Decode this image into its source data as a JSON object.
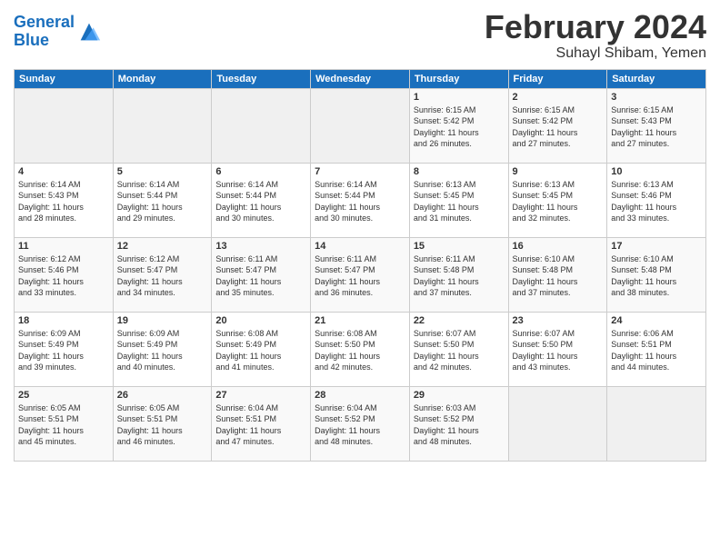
{
  "header": {
    "logo_line1": "General",
    "logo_line2": "Blue",
    "month": "February 2024",
    "location": "Suhayl Shibam, Yemen"
  },
  "days_of_week": [
    "Sunday",
    "Monday",
    "Tuesday",
    "Wednesday",
    "Thursday",
    "Friday",
    "Saturday"
  ],
  "weeks": [
    [
      {
        "day": "",
        "info": ""
      },
      {
        "day": "",
        "info": ""
      },
      {
        "day": "",
        "info": ""
      },
      {
        "day": "",
        "info": ""
      },
      {
        "day": "1",
        "info": "Sunrise: 6:15 AM\nSunset: 5:42 PM\nDaylight: 11 hours\nand 26 minutes."
      },
      {
        "day": "2",
        "info": "Sunrise: 6:15 AM\nSunset: 5:42 PM\nDaylight: 11 hours\nand 27 minutes."
      },
      {
        "day": "3",
        "info": "Sunrise: 6:15 AM\nSunset: 5:43 PM\nDaylight: 11 hours\nand 27 minutes."
      }
    ],
    [
      {
        "day": "4",
        "info": "Sunrise: 6:14 AM\nSunset: 5:43 PM\nDaylight: 11 hours\nand 28 minutes."
      },
      {
        "day": "5",
        "info": "Sunrise: 6:14 AM\nSunset: 5:44 PM\nDaylight: 11 hours\nand 29 minutes."
      },
      {
        "day": "6",
        "info": "Sunrise: 6:14 AM\nSunset: 5:44 PM\nDaylight: 11 hours\nand 30 minutes."
      },
      {
        "day": "7",
        "info": "Sunrise: 6:14 AM\nSunset: 5:44 PM\nDaylight: 11 hours\nand 30 minutes."
      },
      {
        "day": "8",
        "info": "Sunrise: 6:13 AM\nSunset: 5:45 PM\nDaylight: 11 hours\nand 31 minutes."
      },
      {
        "day": "9",
        "info": "Sunrise: 6:13 AM\nSunset: 5:45 PM\nDaylight: 11 hours\nand 32 minutes."
      },
      {
        "day": "10",
        "info": "Sunrise: 6:13 AM\nSunset: 5:46 PM\nDaylight: 11 hours\nand 33 minutes."
      }
    ],
    [
      {
        "day": "11",
        "info": "Sunrise: 6:12 AM\nSunset: 5:46 PM\nDaylight: 11 hours\nand 33 minutes."
      },
      {
        "day": "12",
        "info": "Sunrise: 6:12 AM\nSunset: 5:47 PM\nDaylight: 11 hours\nand 34 minutes."
      },
      {
        "day": "13",
        "info": "Sunrise: 6:11 AM\nSunset: 5:47 PM\nDaylight: 11 hours\nand 35 minutes."
      },
      {
        "day": "14",
        "info": "Sunrise: 6:11 AM\nSunset: 5:47 PM\nDaylight: 11 hours\nand 36 minutes."
      },
      {
        "day": "15",
        "info": "Sunrise: 6:11 AM\nSunset: 5:48 PM\nDaylight: 11 hours\nand 37 minutes."
      },
      {
        "day": "16",
        "info": "Sunrise: 6:10 AM\nSunset: 5:48 PM\nDaylight: 11 hours\nand 37 minutes."
      },
      {
        "day": "17",
        "info": "Sunrise: 6:10 AM\nSunset: 5:48 PM\nDaylight: 11 hours\nand 38 minutes."
      }
    ],
    [
      {
        "day": "18",
        "info": "Sunrise: 6:09 AM\nSunset: 5:49 PM\nDaylight: 11 hours\nand 39 minutes."
      },
      {
        "day": "19",
        "info": "Sunrise: 6:09 AM\nSunset: 5:49 PM\nDaylight: 11 hours\nand 40 minutes."
      },
      {
        "day": "20",
        "info": "Sunrise: 6:08 AM\nSunset: 5:49 PM\nDaylight: 11 hours\nand 41 minutes."
      },
      {
        "day": "21",
        "info": "Sunrise: 6:08 AM\nSunset: 5:50 PM\nDaylight: 11 hours\nand 42 minutes."
      },
      {
        "day": "22",
        "info": "Sunrise: 6:07 AM\nSunset: 5:50 PM\nDaylight: 11 hours\nand 42 minutes."
      },
      {
        "day": "23",
        "info": "Sunrise: 6:07 AM\nSunset: 5:50 PM\nDaylight: 11 hours\nand 43 minutes."
      },
      {
        "day": "24",
        "info": "Sunrise: 6:06 AM\nSunset: 5:51 PM\nDaylight: 11 hours\nand 44 minutes."
      }
    ],
    [
      {
        "day": "25",
        "info": "Sunrise: 6:05 AM\nSunset: 5:51 PM\nDaylight: 11 hours\nand 45 minutes."
      },
      {
        "day": "26",
        "info": "Sunrise: 6:05 AM\nSunset: 5:51 PM\nDaylight: 11 hours\nand 46 minutes."
      },
      {
        "day": "27",
        "info": "Sunrise: 6:04 AM\nSunset: 5:51 PM\nDaylight: 11 hours\nand 47 minutes."
      },
      {
        "day": "28",
        "info": "Sunrise: 6:04 AM\nSunset: 5:52 PM\nDaylight: 11 hours\nand 48 minutes."
      },
      {
        "day": "29",
        "info": "Sunrise: 6:03 AM\nSunset: 5:52 PM\nDaylight: 11 hours\nand 48 minutes."
      },
      {
        "day": "",
        "info": ""
      },
      {
        "day": "",
        "info": ""
      }
    ]
  ]
}
